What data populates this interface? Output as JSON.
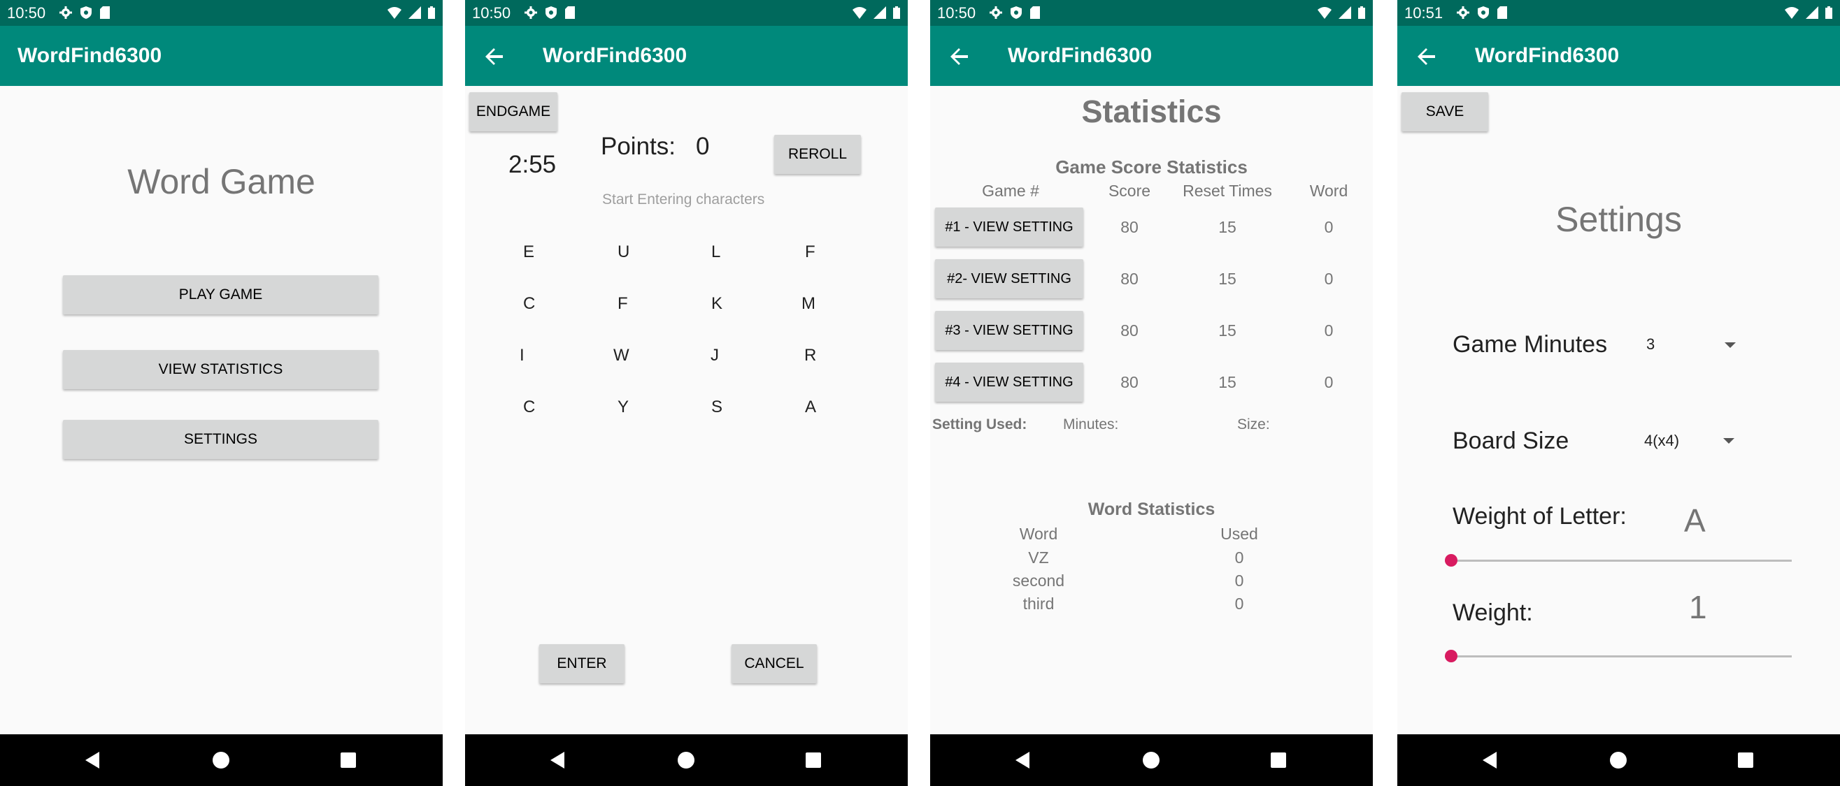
{
  "status_bar": {
    "time_1": "10:50",
    "time_2": "10:50",
    "time_3": "10:50",
    "time_4": "10:51"
  },
  "app_title": "WordFind6300",
  "home": {
    "heading": "Word Game",
    "play_label": "PLAY GAME",
    "stats_label": "VIEW STATISTICS",
    "settings_label": "SETTINGS"
  },
  "game": {
    "endgame_label": "ENDGAME",
    "timer": "2:55",
    "points_label": "Points:",
    "points_value": "0",
    "reroll_label": "REROLL",
    "input_placeholder": "Start Entering characters",
    "grid": [
      [
        "E",
        "U",
        "L",
        "F"
      ],
      [
        "C",
        "F",
        "K",
        "M"
      ],
      [
        "I",
        "W",
        "J",
        "R"
      ],
      [
        "C",
        "Y",
        "S",
        "A"
      ]
    ],
    "enter_label": "ENTER",
    "cancel_label": "CANCEL"
  },
  "stats": {
    "title": "Statistics",
    "game_section_title": "Game Score Statistics",
    "headers": [
      "Game #",
      "Score",
      "Reset Times",
      "Word"
    ],
    "rows": [
      {
        "button": "#1 - VIEW SETTING",
        "score": "80",
        "resets": "15",
        "word": "0"
      },
      {
        "button": "#2- VIEW SETTING",
        "score": "80",
        "resets": "15",
        "word": "0"
      },
      {
        "button": "#3 - VIEW SETTING",
        "score": "80",
        "resets": "15",
        "word": "0"
      },
      {
        "button": "#4 - VIEW SETTING",
        "score": "80",
        "resets": "15",
        "word": "0"
      }
    ],
    "setting_used_label": "Setting Used:",
    "minutes_label": "Minutes:",
    "size_label": "Size:",
    "word_section_title": "Word Statistics",
    "word_headers": [
      "Word",
      "Used"
    ],
    "word_rows": [
      {
        "word": "VZ",
        "used": "0"
      },
      {
        "word": "second",
        "used": "0"
      },
      {
        "word": "third",
        "used": "0"
      }
    ]
  },
  "settings": {
    "save_label": "SAVE",
    "title": "Settings",
    "game_minutes_label": "Game Minutes",
    "game_minutes_value": "3",
    "board_size_label": "Board Size",
    "board_size_value": "4(x4)",
    "weight_letter_label": "Weight of Letter:",
    "weight_letter_value": "A",
    "weight_label": "Weight:",
    "weight_value": "1",
    "letter_slider_level": 0,
    "weight_slider_level": 0
  },
  "colors": {
    "status_bar": "#00695c",
    "app_bar": "#00897b",
    "accent": "#d81b60"
  }
}
